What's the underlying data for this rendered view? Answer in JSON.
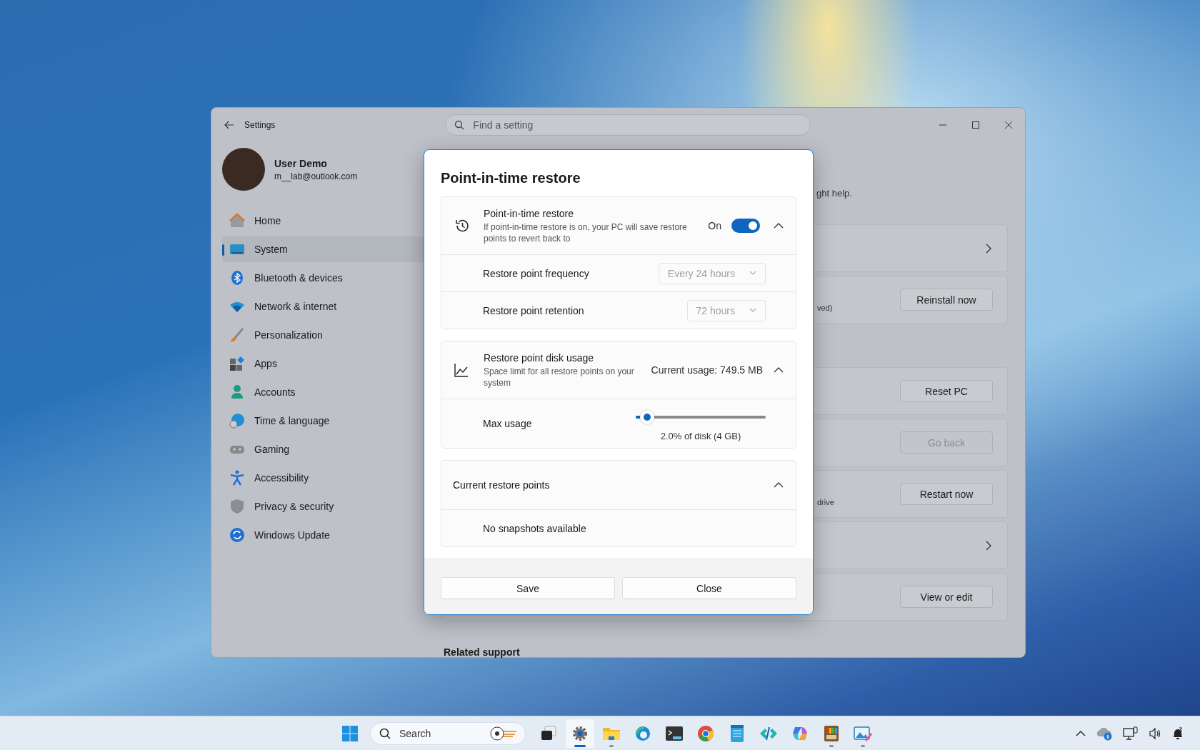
{
  "window": {
    "title": "Settings"
  },
  "search": {
    "placeholder": "Find a setting"
  },
  "account": {
    "name": "User Demo",
    "email": "m__lab@outlook.com"
  },
  "nav": [
    {
      "label": "Home",
      "selected": false
    },
    {
      "label": "System",
      "selected": true
    },
    {
      "label": "Bluetooth & devices",
      "selected": false
    },
    {
      "label": "Network & internet",
      "selected": false
    },
    {
      "label": "Personalization",
      "selected": false
    },
    {
      "label": "Apps",
      "selected": false
    },
    {
      "label": "Accounts",
      "selected": false
    },
    {
      "label": "Time & language",
      "selected": false
    },
    {
      "label": "Gaming",
      "selected": false
    },
    {
      "label": "Accessibility",
      "selected": false
    },
    {
      "label": "Privacy & security",
      "selected": false
    },
    {
      "label": "Windows Update",
      "selected": false
    }
  ],
  "page": {
    "intro": "ght help.",
    "rows": [
      {
        "kind": "link"
      },
      {
        "kind": "button",
        "note": "ved)",
        "button": "Reinstall now",
        "disabled": false
      },
      {
        "kind": "button",
        "button": "Reset PC",
        "disabled": false
      },
      {
        "kind": "button",
        "button": "Go back",
        "disabled": true
      },
      {
        "kind": "button",
        "note": "drive",
        "button": "Restart now",
        "disabled": false
      },
      {
        "kind": "link"
      },
      {
        "kind": "button",
        "button": "View or edit",
        "disabled": false
      }
    ],
    "related": "Related support"
  },
  "dialog": {
    "title": "Point-in-time restore",
    "restore": {
      "title": "Point-in-time restore",
      "description": "If point-in-time restore is on, your PC will save restore points to revert back to",
      "state_label": "On",
      "on": true,
      "expanded": true,
      "settings": [
        {
          "label": "Restore point frequency",
          "value": "Every 24 hours",
          "disabled": true
        },
        {
          "label": "Restore point retention",
          "value": "72 hours",
          "disabled": true
        }
      ]
    },
    "disk": {
      "title": "Restore point disk usage",
      "description": "Space limit for all restore points on your system",
      "usage": "Current usage: 749.5 MB",
      "expanded": true,
      "max_label": "Max usage",
      "level": 0.04,
      "reading": "2.0% of disk (4 GB)"
    },
    "points": {
      "title": "Current restore points",
      "expanded": true,
      "empty": "No snapshots available"
    },
    "buttons": [
      "Save",
      "Close"
    ]
  },
  "taskbar": {
    "search_placeholder": "Search",
    "apps": [
      {
        "selected": false,
        "open": false
      },
      {
        "selected": true,
        "open": true
      },
      {
        "selected": false,
        "open": true
      },
      {
        "selected": false,
        "open": false
      },
      {
        "selected": false,
        "open": false
      },
      {
        "selected": false,
        "open": false
      },
      {
        "selected": false,
        "open": false
      },
      {
        "selected": false,
        "open": false
      },
      {
        "selected": false,
        "open": false
      },
      {
        "selected": false,
        "open": true
      },
      {
        "selected": false,
        "open": true
      }
    ]
  }
}
